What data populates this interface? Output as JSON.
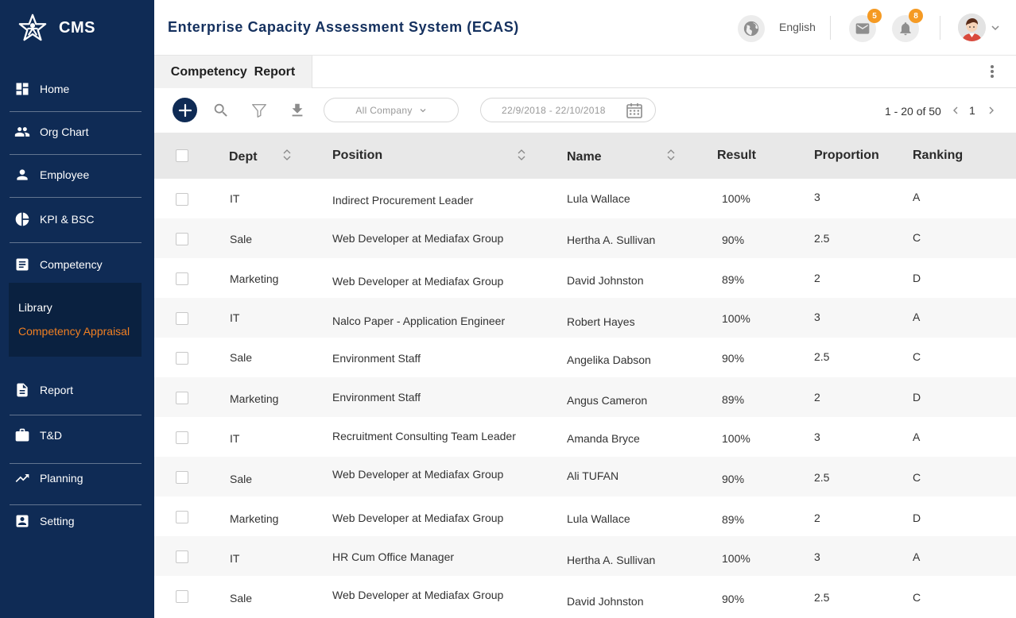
{
  "brand": {
    "name": "CMS"
  },
  "sidebar": {
    "items": [
      {
        "label": "Home",
        "icon": "dashboard-icon"
      },
      {
        "label": "Org Chart",
        "icon": "people-icon"
      },
      {
        "label": "Employee",
        "icon": "person-icon"
      },
      {
        "label": "KPI & BSC",
        "icon": "pie-chart-icon"
      },
      {
        "label": "Competency",
        "icon": "list-icon"
      },
      {
        "label": "Report",
        "icon": "document-icon"
      },
      {
        "label": "T&D",
        "icon": "briefcase-icon"
      },
      {
        "label": "Planning",
        "icon": "trending-up-icon"
      },
      {
        "label": "Setting",
        "icon": "account-box-icon"
      }
    ],
    "competency_submenu": [
      {
        "label": "Library",
        "active": false
      },
      {
        "label": "Competency Appraisal",
        "active": true
      }
    ],
    "active_color": "#f07f22",
    "background": "#0f2b55"
  },
  "header": {
    "title": "Enterprise Capacity Assessment System (ECAS)",
    "language": "English",
    "mail_count": "5",
    "notification_count": "8"
  },
  "tabs": [
    {
      "label": "Competency  Report"
    }
  ],
  "toolbar": {
    "company_select": "All Company",
    "date_range": "22/9/2018 - 22/10/2018",
    "pagination_range": "1 - 20 of 50",
    "current_page": "1"
  },
  "table": {
    "columns": [
      "Dept",
      "Position",
      "Name",
      "Result",
      "Proportion",
      "Ranking"
    ],
    "rows": [
      {
        "dept": "IT",
        "position": "Indirect Procurement Leader",
        "name": "Lula Wallace",
        "result": "100%",
        "proportion": "3",
        "ranking": "A"
      },
      {
        "dept": "Sale",
        "position": "Web Developer at Mediafax Group",
        "name": "Hertha A. Sullivan",
        "result": "90%",
        "proportion": "2.5",
        "ranking": "C"
      },
      {
        "dept": "Marketing",
        "position": "Web Developer at Mediafax Group",
        "name": "David Johnston",
        "result": "89%",
        "proportion": "2",
        "ranking": "D"
      },
      {
        "dept": "IT",
        "position": "Nalco Paper - Application Engineer",
        "name": "Robert Hayes",
        "result": "100%",
        "proportion": "3",
        "ranking": "A"
      },
      {
        "dept": "Sale",
        "position": "Environment Staff",
        "name": "Angelika Dabson",
        "result": "90%",
        "proportion": "2.5",
        "ranking": "C"
      },
      {
        "dept": "Marketing",
        "position": "Environment Staff",
        "name": "Angus Cameron",
        "result": "89%",
        "proportion": "2",
        "ranking": "D"
      },
      {
        "dept": "IT",
        "position": "Recruitment Consulting Team Leader",
        "name": "Amanda Bryce",
        "result": "100%",
        "proportion": "3",
        "ranking": "A"
      },
      {
        "dept": "Sale",
        "position": "Web Developer at Mediafax Group",
        "name": "Ali TUFAN",
        "result": "90%",
        "proportion": "2.5",
        "ranking": "C"
      },
      {
        "dept": "Marketing",
        "position": "Web Developer at Mediafax Group",
        "name": "Lula Wallace",
        "result": "89%",
        "proportion": "2",
        "ranking": "D"
      },
      {
        "dept": "IT",
        "position": "HR Cum Office Manager",
        "name": "Hertha A. Sullivan",
        "result": "100%",
        "proportion": "3",
        "ranking": "A"
      },
      {
        "dept": "Sale",
        "position": "Web Developer at Mediafax Group",
        "name": "David Johnston",
        "result": "90%",
        "proportion": "2.5",
        "ranking": "C"
      }
    ]
  }
}
